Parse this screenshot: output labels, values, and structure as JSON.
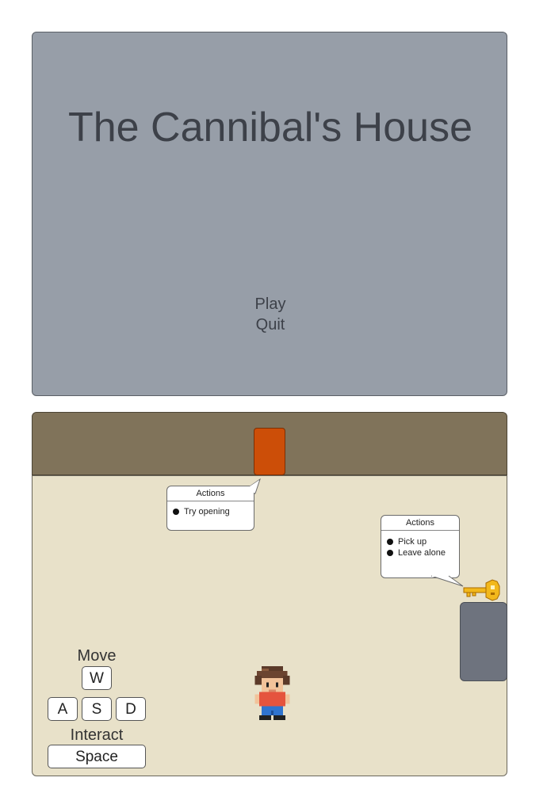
{
  "title_screen": {
    "title": "The Cannibal's House",
    "menu": [
      "Play",
      "Quit"
    ]
  },
  "room": {
    "door_popup": {
      "title": "Actions",
      "options": [
        "Try opening"
      ]
    },
    "key_popup": {
      "title": "Actions",
      "options": [
        "Pick up",
        "Leave alone"
      ]
    }
  },
  "controls": {
    "move_label": "Move",
    "keys": [
      "W",
      "A",
      "S",
      "D"
    ],
    "interact_label": "Interact",
    "interact_key": "Space"
  },
  "colors": {
    "title_bg": "#979ea8",
    "wall": "#80735a",
    "door": "#cc4e08",
    "floor": "#e8e1c9",
    "cabinet": "#6e737e",
    "key_gold": "#f2b81c"
  },
  "icons": [
    "key-icon",
    "player-character-icon"
  ]
}
